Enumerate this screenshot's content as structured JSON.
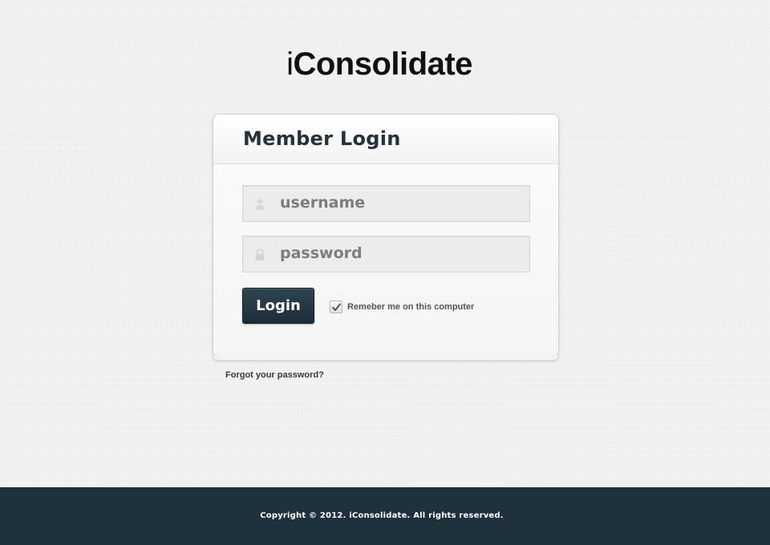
{
  "logo": {
    "prefix": "i",
    "rest": "Consolidate"
  },
  "login_card": {
    "title": "Member Login",
    "username_field": {
      "placeholder": "username",
      "value": "",
      "icon": "user-icon"
    },
    "password_field": {
      "placeholder": "password",
      "value": "",
      "icon": "lock-icon"
    },
    "login_button_label": "Login",
    "remember_me": {
      "label": "Remeber me on this computer",
      "checked": true
    }
  },
  "forgot_password_link": "Forgot your password?",
  "footer": {
    "copyright": "Copyright © 2012. iConsolidate. All rights reserved."
  },
  "colors": {
    "accent": "#1e323e",
    "background": "#efefef",
    "title_text": "#23323d"
  }
}
